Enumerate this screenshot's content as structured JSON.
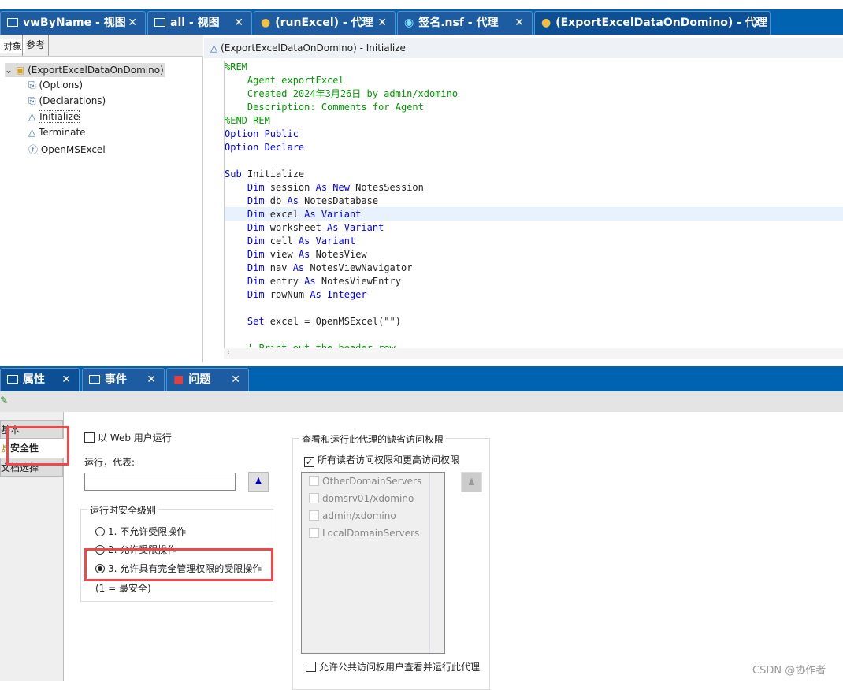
{
  "editor_tabs": [
    {
      "label": "vwByName - 视图",
      "icon": "view-icon"
    },
    {
      "label": "all - 视图",
      "icon": "view-icon"
    },
    {
      "label": "(runExcel) - 代理",
      "icon": "agent-icon"
    },
    {
      "label": "签名.nsf - 代理",
      "icon": "database-icon"
    },
    {
      "label": "(ExportExcelDataOnDomino) - 代理",
      "icon": "agent-icon"
    }
  ],
  "close_glyph": "✕",
  "left_panel": {
    "tabs": [
      "对象",
      "参考"
    ],
    "root": "(ExportExcelDataOnDomino)",
    "items": [
      "(Options)",
      "(Declarations)",
      "Initialize",
      "Terminate",
      "OpenMSExcel"
    ],
    "selected": "Initialize"
  },
  "editor": {
    "header": "(ExportExcelDataOnDomino) - Initialize",
    "lines": [
      [
        [
          "cm",
          "%REM"
        ]
      ],
      [
        [
          "cm",
          "    Agent exportExcel"
        ]
      ],
      [
        [
          "cm",
          "    Created 2024年3月26日 by admin/xdomino"
        ]
      ],
      [
        [
          "cm",
          "    Description: Comments for Agent"
        ]
      ],
      [
        [
          "cm",
          "%END REM"
        ]
      ],
      [
        [
          "kw",
          "Option Public"
        ]
      ],
      [
        [
          "kw",
          "Option Declare"
        ]
      ],
      [],
      [
        [
          "kw",
          "Sub"
        ],
        [
          "",
          "Initialize"
        ]
      ],
      [
        [
          "kw",
          "    Dim"
        ],
        [
          "",
          "session"
        ],
        [
          "kw",
          "As New"
        ],
        [
          "",
          "NotesSession"
        ]
      ],
      [
        [
          "kw",
          "    Dim"
        ],
        [
          "",
          "db"
        ],
        [
          "kw",
          "As"
        ],
        [
          "",
          "NotesDatabase"
        ]
      ],
      [
        [
          "kw",
          "    Dim"
        ],
        [
          "",
          "excel"
        ],
        [
          "kw",
          "As Variant"
        ]
      ],
      [
        [
          "kw",
          "    Dim"
        ],
        [
          "",
          "worksheet"
        ],
        [
          "kw",
          "As Variant"
        ]
      ],
      [
        [
          "kw",
          "    Dim"
        ],
        [
          "",
          "cell"
        ],
        [
          "kw",
          "As Variant"
        ]
      ],
      [
        [
          "kw",
          "    Dim"
        ],
        [
          "",
          "view"
        ],
        [
          "kw",
          "As"
        ],
        [
          "",
          "NotesView"
        ]
      ],
      [
        [
          "kw",
          "    Dim"
        ],
        [
          "",
          "nav"
        ],
        [
          "kw",
          "As"
        ],
        [
          "",
          "NotesViewNavigator"
        ]
      ],
      [
        [
          "kw",
          "    Dim"
        ],
        [
          "",
          "entry"
        ],
        [
          "kw",
          "As"
        ],
        [
          "",
          "NotesViewEntry"
        ]
      ],
      [
        [
          "kw",
          "    Dim"
        ],
        [
          "",
          "rowNum"
        ],
        [
          "kw",
          "As Integer"
        ]
      ],
      [],
      [
        [
          "kw",
          "    Set"
        ],
        [
          "",
          "excel = OpenMSExcel(\"\")"
        ]
      ],
      [],
      [
        [
          "cm",
          "    ' Print out the header row"
        ]
      ]
    ]
  },
  "bottom_tabs": [
    {
      "label": "属性",
      "icon": "properties-icon"
    },
    {
      "label": "事件",
      "icon": "events-icon"
    },
    {
      "label": "问题",
      "icon": "problems-icon"
    }
  ],
  "props": {
    "side_tabs": [
      "基本",
      "安全性",
      "文档选择"
    ],
    "run_as_web_user": "以 Web 用户运行",
    "run_on_behalf": "运行，代表:",
    "run_on_behalf_value": "",
    "security_level_title": "运行时安全级别",
    "levels": [
      "1. 不允许受限操作",
      "2. 允许受限操作",
      "3. 允许具有完全管理权限的受限操作"
    ],
    "selected_level": 3,
    "level_note": "(1 = 最安全)",
    "access_title": "查看和运行此代理的缺省访问权限",
    "all_readers": "所有读者访问权限和更高访问权限",
    "all_readers_checked": true,
    "access_list": [
      "OtherDomainServers",
      "domsrv01/xdomino",
      "admin/xdomino",
      "LocalDomainServers"
    ],
    "public_access": "允许公共访问权用户查看并运行此代理"
  },
  "watermark": "CSDN @协作者",
  "colors": {
    "tabbar": "#0063b1",
    "highlight": "#ff4444"
  }
}
